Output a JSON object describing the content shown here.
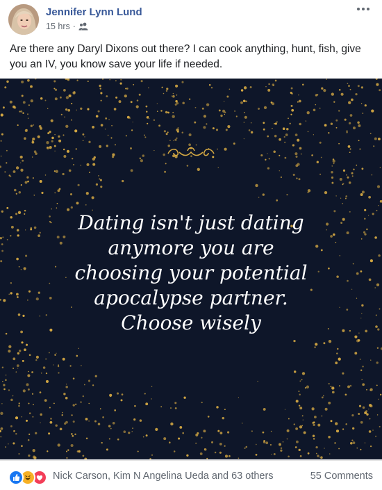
{
  "post": {
    "author": "Jennifer Lynn Lund",
    "time": "15 hrs",
    "separator": "·",
    "audience_icon": "friends-icon",
    "text": "Are there any Daryl Dixons out there? I can cook anything, hunt, fish, give you an IV, you know save your life if needed."
  },
  "image": {
    "background_color": "#0e1629",
    "dot_color": "#d4a843",
    "ornament_icon": "flourish-ornament-icon",
    "quote_lines": [
      "Dating isn't just dating",
      "anymore you are",
      "choosing your potential",
      "apocalypse partner.",
      "Choose wisely"
    ]
  },
  "footer": {
    "reaction_icons": [
      "like-icon",
      "haha-icon",
      "love-icon"
    ],
    "reactors": "Nick Carson, Kim N Angelina Ueda and 63 others",
    "comments": "55 Comments"
  },
  "colors": {
    "author_link": "#385898",
    "meta_text": "#606770",
    "like": "#1877f2",
    "haha": "#f7b125",
    "love": "#f33e58"
  }
}
